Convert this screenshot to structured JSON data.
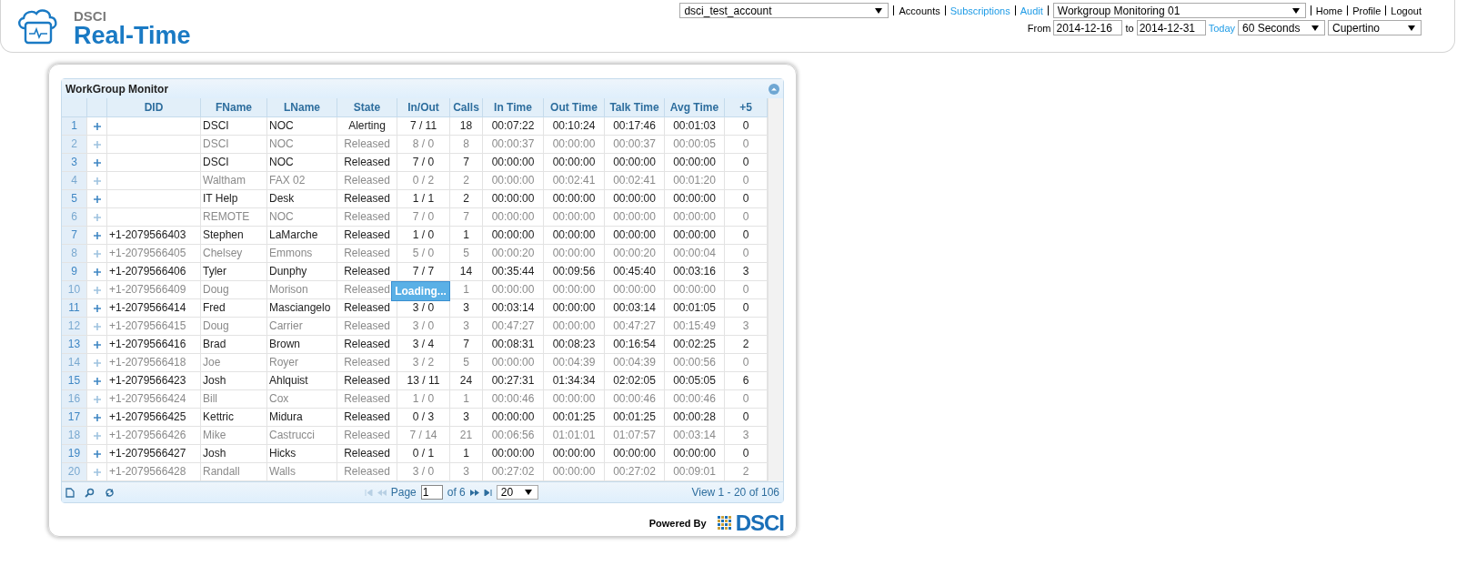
{
  "header": {
    "brand_small": "DSCI",
    "brand": "Real-Time",
    "account": "dsci_test_account",
    "links": [
      {
        "label": "Accounts",
        "color": "#000000"
      },
      {
        "label": "Subscriptions",
        "color": "#1e9be6"
      },
      {
        "label": "Audit",
        "color": "#1e9be6"
      }
    ],
    "monitor": "Workgroup Monitoring 01",
    "user_links": [
      {
        "label": "Home"
      },
      {
        "label": "Profile"
      },
      {
        "label": "Logout"
      }
    ],
    "from_label": "From",
    "from": "2014-12-16",
    "to_label": "to",
    "to": "2014-12-31",
    "today": "Today",
    "interval": "60 Seconds",
    "location": "Cupertino"
  },
  "grid": {
    "title": "WorkGroup Monitor",
    "columns": [
      "DID",
      "FName",
      "LName",
      "State",
      "In/Out",
      "Calls",
      "In Time",
      "Out Time",
      "Talk Time",
      "Avg Time",
      "+5"
    ],
    "rows": [
      {
        "num": "1",
        "dimmed": false,
        "cells": [
          null,
          "DSCI",
          "NOC",
          "Alerting",
          "7 / 11",
          "18",
          "00:07:22",
          "00:10:24",
          "00:17:46",
          "00:01:03",
          "0"
        ]
      },
      {
        "num": "2",
        "dimmed": true,
        "cells": [
          null,
          "DSCI",
          "NOC",
          "Released",
          "8 / 0",
          "8",
          "00:00:37",
          "00:00:00",
          "00:00:37",
          "00:00:05",
          "0"
        ]
      },
      {
        "num": "3",
        "dimmed": false,
        "cells": [
          null,
          "DSCI",
          "NOC",
          "Released",
          "7 / 0",
          "7",
          "00:00:00",
          "00:00:00",
          "00:00:00",
          "00:00:00",
          "0"
        ]
      },
      {
        "num": "4",
        "dimmed": true,
        "cells": [
          null,
          "Waltham",
          "FAX 02",
          "Released",
          "0 / 2",
          "2",
          "00:00:00",
          "00:02:41",
          "00:02:41",
          "00:01:20",
          "0"
        ]
      },
      {
        "num": "5",
        "dimmed": false,
        "cells": [
          null,
          "IT Help",
          "Desk",
          "Released",
          "1 / 1",
          "2",
          "00:00:00",
          "00:00:00",
          "00:00:00",
          "00:00:00",
          "0"
        ]
      },
      {
        "num": "6",
        "dimmed": true,
        "cells": [
          null,
          "REMOTE",
          "NOC",
          "Released",
          "7 / 0",
          "7",
          "00:00:00",
          "00:00:00",
          "00:00:00",
          "00:00:00",
          "0"
        ]
      },
      {
        "num": "7",
        "dimmed": false,
        "cells": [
          "+1-2079566403",
          "Stephen",
          "LaMarche",
          "Released",
          "1 / 0",
          "1",
          "00:00:00",
          "00:00:00",
          "00:00:00",
          "00:00:00",
          "0"
        ]
      },
      {
        "num": "8",
        "dimmed": true,
        "cells": [
          "+1-2079566405",
          "Chelsey",
          "Emmons",
          "Released",
          "5 / 0",
          "5",
          "00:00:20",
          "00:00:00",
          "00:00:20",
          "00:00:04",
          "0"
        ]
      },
      {
        "num": "9",
        "dimmed": false,
        "cells": [
          "+1-2079566406",
          "Tyler",
          "Dunphy",
          "Released",
          "7 / 7",
          "14",
          "00:35:44",
          "00:09:56",
          "00:45:40",
          "00:03:16",
          "3"
        ]
      },
      {
        "num": "10",
        "dimmed": true,
        "cells": [
          "+1-2079566409",
          "Doug",
          "Morison",
          "Released",
          null,
          "1",
          "00:00:00",
          "00:00:00",
          "00:00:00",
          "00:00:00",
          "0"
        ]
      },
      {
        "num": "11",
        "dimmed": false,
        "cells": [
          "+1-2079566414",
          "Fred",
          "Masciangelo",
          "Released",
          "3 / 0",
          "3",
          "00:03:14",
          "00:00:00",
          "00:03:14",
          "00:01:05",
          "0"
        ]
      },
      {
        "num": "12",
        "dimmed": true,
        "cells": [
          "+1-2079566415",
          "Doug",
          "Carrier",
          "Released",
          "3 / 0",
          "3",
          "00:47:27",
          "00:00:00",
          "00:47:27",
          "00:15:49",
          "3"
        ]
      },
      {
        "num": "13",
        "dimmed": false,
        "cells": [
          "+1-2079566416",
          "Brad",
          "Brown",
          "Released",
          "3 / 4",
          "7",
          "00:08:31",
          "00:08:23",
          "00:16:54",
          "00:02:25",
          "2"
        ]
      },
      {
        "num": "14",
        "dimmed": true,
        "cells": [
          "+1-2079566418",
          "Joe",
          "Royer",
          "Released",
          "3 / 2",
          "5",
          "00:00:00",
          "00:04:39",
          "00:04:39",
          "00:00:56",
          "0"
        ]
      },
      {
        "num": "15",
        "dimmed": false,
        "cells": [
          "+1-2079566423",
          "Josh",
          "Ahlquist",
          "Released",
          "13 / 11",
          "24",
          "00:27:31",
          "01:34:34",
          "02:02:05",
          "00:05:05",
          "6"
        ]
      },
      {
        "num": "16",
        "dimmed": true,
        "cells": [
          "+1-2079566424",
          "Bill",
          "Cox",
          "Released",
          "1 / 0",
          "1",
          "00:00:46",
          "00:00:00",
          "00:00:46",
          "00:00:46",
          "0"
        ]
      },
      {
        "num": "17",
        "dimmed": false,
        "cells": [
          "+1-2079566425",
          "Kettric",
          "Midura",
          "Released",
          "0 / 3",
          "3",
          "00:00:00",
          "00:01:25",
          "00:01:25",
          "00:00:28",
          "0"
        ]
      },
      {
        "num": "18",
        "dimmed": true,
        "cells": [
          "+1-2079566426",
          "Mike",
          "Castrucci",
          "Released",
          "7 / 14",
          "21",
          "00:06:56",
          "01:01:01",
          "01:07:57",
          "00:03:14",
          "3"
        ]
      },
      {
        "num": "19",
        "dimmed": false,
        "cells": [
          "+1-2079566427",
          "Josh",
          "Hicks",
          "Released",
          "0 / 1",
          "1",
          "00:00:00",
          "00:00:00",
          "00:00:00",
          "00:00:00",
          "0"
        ]
      },
      {
        "num": "20",
        "dimmed": true,
        "cells": [
          "+1-2079566428",
          "Randall",
          "Walls",
          "Released",
          "3 / 0",
          "3",
          "00:27:02",
          "00:00:00",
          "00:27:02",
          "00:09:01",
          "2"
        ]
      }
    ],
    "loading": "Loading...",
    "pager": {
      "page_label": "Page",
      "page": "1",
      "of": "of 6",
      "rows_per_page": "20",
      "view": "View 1 - 20 of 106"
    }
  },
  "footer": {
    "powered_by": "Powered By",
    "logo": "DSCI"
  }
}
